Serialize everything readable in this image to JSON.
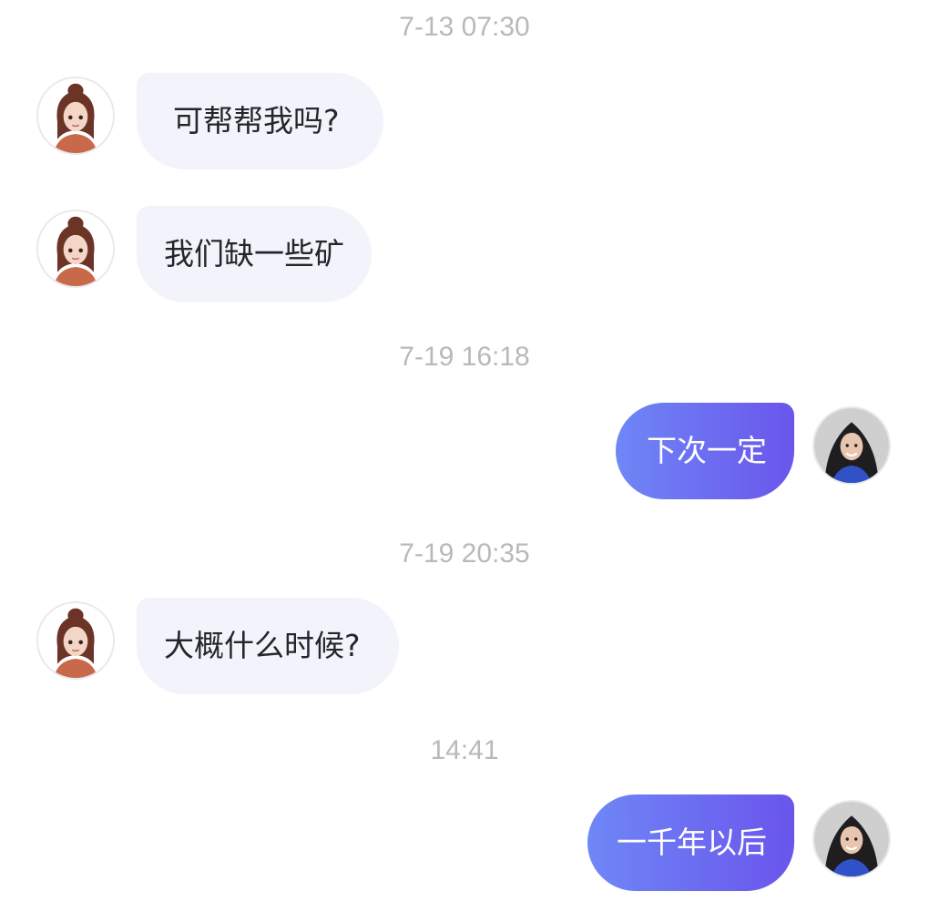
{
  "messages": [
    {
      "time": "7-13 07:30"
    },
    {
      "text": "可帮帮我吗?"
    },
    {
      "text": "我们缺一些矿"
    },
    {
      "time": "7-19 16:18"
    },
    {
      "text": "下次一定"
    },
    {
      "time": "7-19 20:35"
    },
    {
      "text": "大概什么时候?"
    },
    {
      "time": "14:41"
    },
    {
      "text": "一千年以后"
    }
  ],
  "colors": {
    "incoming_bubble": "#f3f4fb",
    "outgoing_gradient_start": "#6f87f6",
    "outgoing_gradient_end": "#6a55ec",
    "timestamp": "#b9b9bd"
  },
  "icons": {
    "contact_avatar": "girl-3d-avatar-icon",
    "self_avatar": "woman-photo-avatar-icon"
  }
}
